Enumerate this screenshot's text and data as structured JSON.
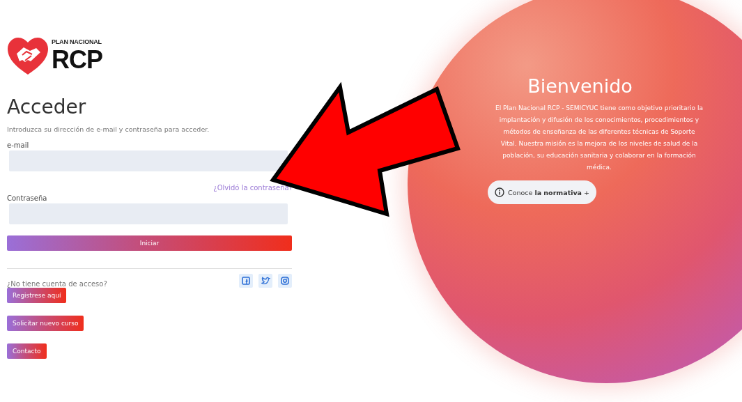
{
  "logo": {
    "subtitle": "PLAN NACIONAL",
    "title": "RCP"
  },
  "login": {
    "title": "Acceder",
    "intro": "Introduzca su dirección de e-mail y contraseña para acceder.",
    "fields": [
      {
        "label": "e-mail"
      },
      {
        "label": "Contraseña"
      }
    ],
    "forgot_link": "¿Olvidó la contraseña?",
    "submit": "Iniciar"
  },
  "signup": {
    "question": "¿No tiene cuenta de acceso?",
    "social": [
      {
        "kind": "facebook"
      },
      {
        "kind": "twitter"
      },
      {
        "kind": "instagram"
      }
    ],
    "buttons": [
      "Registrese aquí",
      "Solicitar nuevo curso",
      "Contacto"
    ]
  },
  "welcome": {
    "title": "Bienvenido",
    "text": "El Plan Nacional RCP - SEMICYUC tiene como objetivo prioritario la implantación y difusión de los conocimientos, procedimientos y métodos de enseñanza de las diferentes técnicas de Soporte Vital. Nuestra misión es la mejora de los niveles de salud de la población, su educación sanitaria y colaborar en la formación médica.",
    "button": "Conoce **la normativa** +"
  }
}
